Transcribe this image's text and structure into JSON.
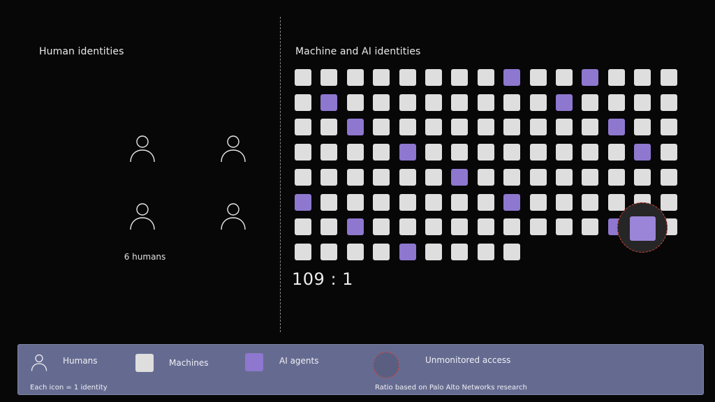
{
  "human_panel": {
    "heading": "Human identities",
    "count_label": "6 humans"
  },
  "machine_panel": {
    "heading": "Machine and AI identities",
    "ratio": "109 : 1",
    "grid": {
      "columns": 15,
      "rows": [
        "MMMMMMMMAMMAMMM",
        "MAMMMMMMMMAMMMM",
        "MMAMMMMMMMMMAMM",
        "MMMMAMMMMMMMMAM",
        "MMMMMMAMMMMMMMM",
        "AMMMMMMMAMMMMMM",
        "MMAMMMMMMMMMA.M",
        "MMMMAMMMM"
      ],
      "legend": {
        "M": "machine",
        "A": "ai-agent",
        ".": "unmonitored-agent"
      }
    }
  },
  "legend": {
    "humans_label": "Humans",
    "machines_label": "Machines",
    "ai_agents_label": "AI agents",
    "unmonitored_label": "Unmonitored access",
    "note_identity": "Each icon = 1 identity",
    "note_source": "Ratio based on Palo Alto Networks research"
  },
  "colors": {
    "background": "#070707",
    "machine": "#dedede",
    "ai_agent": "#8e77cf",
    "unmonitored_outline": "#e2433d",
    "legend_bar": "#656b90"
  },
  "icons": {
    "human": "person-outline-icon",
    "unmonitored": "dashed-circle-icon"
  }
}
